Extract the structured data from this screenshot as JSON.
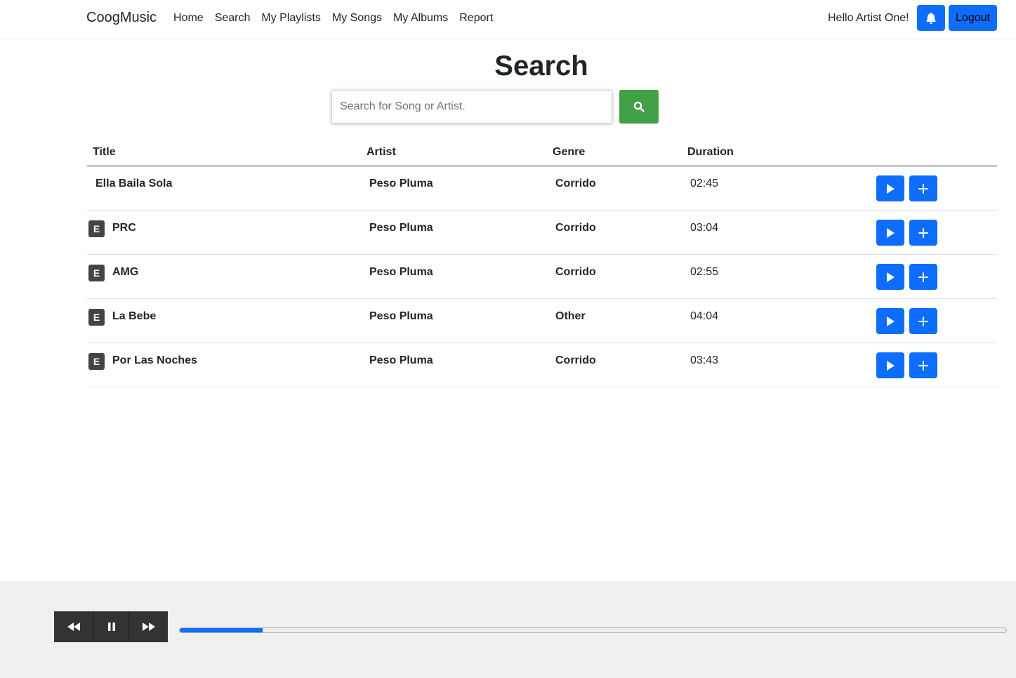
{
  "navbar": {
    "brand": "CoogMusic",
    "links": [
      "Home",
      "Search",
      "My Playlists",
      "My Songs",
      "My Albums",
      "Report"
    ],
    "greeting": "Hello Artist One!",
    "logout_label": "Logout"
  },
  "search": {
    "title": "Search",
    "placeholder": "Search for Song or Artist."
  },
  "table": {
    "headers": [
      "Title",
      "Artist",
      "Genre",
      "Duration"
    ],
    "rows": [
      {
        "explicit": "",
        "title": "Ella Baila Sola",
        "artist": "Peso Pluma",
        "genre": "Corrido",
        "duration": "02:45"
      },
      {
        "explicit": "E",
        "title": "PRC",
        "artist": "Peso Pluma",
        "genre": "Corrido",
        "duration": "03:04"
      },
      {
        "explicit": "E",
        "title": "AMG",
        "artist": "Peso Pluma",
        "genre": "Corrido",
        "duration": "02:55"
      },
      {
        "explicit": "E",
        "title": "La Bebe",
        "artist": "Peso Pluma",
        "genre": "Other",
        "duration": "04:04"
      },
      {
        "explicit": "E",
        "title": "Por Las Noches",
        "artist": "Peso Pluma",
        "genre": "Corrido",
        "duration": "03:43"
      }
    ]
  },
  "player": {
    "progress": 0.1
  },
  "colors": {
    "primary": "#0d6efd",
    "search_button": "#43a047",
    "player_bg": "#f0f0f0",
    "controls_bg": "#333333"
  },
  "icons": {
    "notification": "bell-icon",
    "search": "search-icon",
    "play": "play-icon",
    "add": "plus-icon",
    "rewind": "rewind-icon",
    "pause": "pause-icon",
    "forward": "fast-forward-icon"
  }
}
